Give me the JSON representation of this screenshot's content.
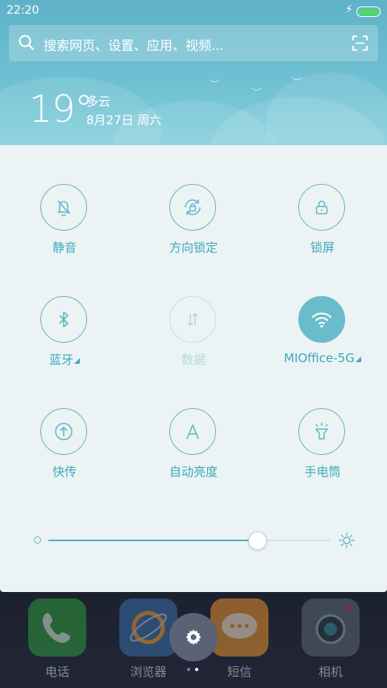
{
  "status": {
    "time": "22:20"
  },
  "search": {
    "placeholder": "搜索网页、设置、应用、视频..."
  },
  "weather": {
    "temperature": "19°",
    "condition": "多云",
    "date": "8月27日 周六"
  },
  "tiles": [
    {
      "id": "mute",
      "label": "静音",
      "icon": "bell-off-icon",
      "state": "off"
    },
    {
      "id": "rotation",
      "label": "方向锁定",
      "icon": "rotation-lock-icon",
      "state": "off"
    },
    {
      "id": "lock",
      "label": "锁屏",
      "icon": "lock-icon",
      "state": "off"
    },
    {
      "id": "bluetooth",
      "label": "蓝牙",
      "icon": "bluetooth-icon",
      "state": "off",
      "expand": true
    },
    {
      "id": "data",
      "label": "数据",
      "icon": "data-arrows-icon",
      "state": "disabled"
    },
    {
      "id": "wifi",
      "label": "MIOffice-5G",
      "icon": "wifi-icon",
      "state": "on",
      "expand": true
    },
    {
      "id": "share",
      "label": "快传",
      "icon": "upload-circle-icon",
      "state": "off"
    },
    {
      "id": "auto_brightness",
      "label": "自动亮度",
      "icon": "letter-a-icon",
      "state": "off"
    },
    {
      "id": "flashlight",
      "label": "手电筒",
      "icon": "flashlight-icon",
      "state": "off"
    }
  ],
  "brightness": {
    "level": 0.74
  },
  "dock": [
    {
      "label": "电话",
      "icon": "phone-icon",
      "color": "#2f9a3a"
    },
    {
      "label": "浏览器",
      "icon": "browser-icon",
      "color": "#3a6ea8"
    },
    {
      "label": "短信",
      "icon": "message-icon",
      "color": "#e8902c"
    },
    {
      "label": "相机",
      "icon": "camera-icon",
      "color": "#5d6673"
    }
  ],
  "colors": {
    "accent": "#3fa9bb",
    "active": "#6bbccb"
  }
}
